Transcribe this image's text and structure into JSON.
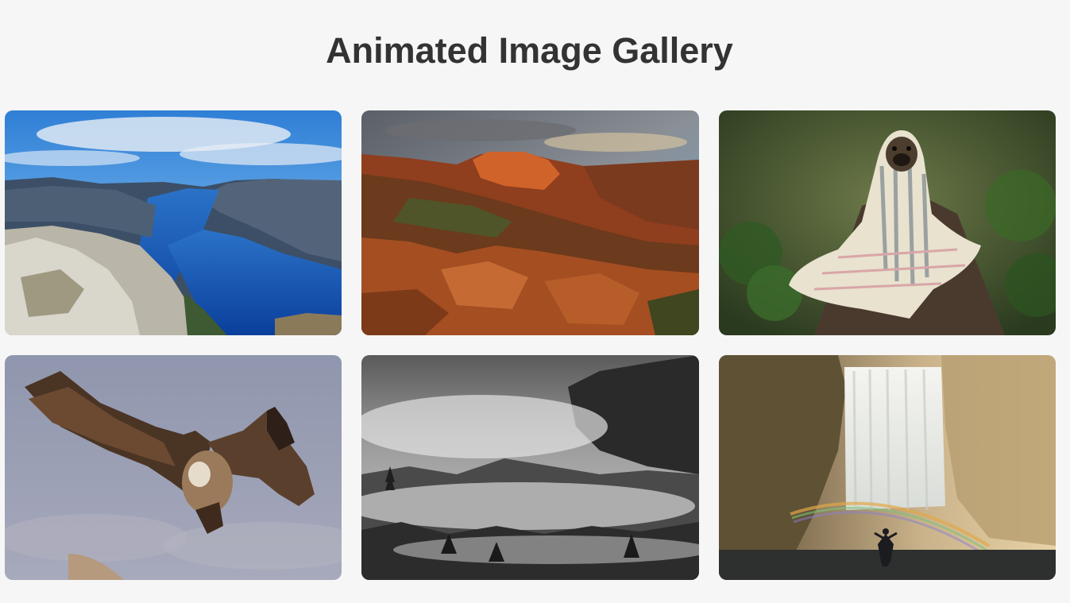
{
  "page": {
    "title": "Animated Image Gallery"
  },
  "gallery": {
    "images": [
      {
        "subject": "fjord-cliffs",
        "icon": "fjord-landscape-image"
      },
      {
        "subject": "red-rock-canyon-sunset",
        "icon": "canyon-landscape-image"
      },
      {
        "subject": "pug-in-blanket",
        "icon": "pug-dog-image"
      },
      {
        "subject": "vulture-in-flight",
        "icon": "vulture-bird-image"
      },
      {
        "subject": "misty-forest-bw",
        "icon": "misty-forest-image"
      },
      {
        "subject": "waterfall-with-rainbow",
        "icon": "waterfall-image"
      }
    ]
  },
  "colors": {
    "background": "#f6f6f6",
    "title": "#333333"
  }
}
